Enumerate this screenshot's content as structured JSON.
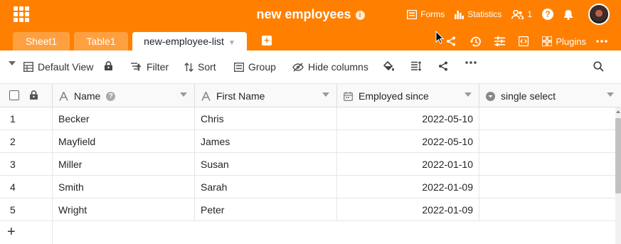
{
  "header": {
    "title": "new employees",
    "info": "i",
    "forms_label": "Forms",
    "statistics_label": "Statistics",
    "collaborators_count": "1",
    "help": "?"
  },
  "tabs": {
    "sheet1": "Sheet1",
    "table1": "Table1",
    "active": "new-employee-list"
  },
  "tab_tools": {
    "plugins_label": "Plugins"
  },
  "toolbar": {
    "view_label": "Default View",
    "filter_label": "Filter",
    "sort_label": "Sort",
    "group_label": "Group",
    "hide_columns_label": "Hide columns"
  },
  "columns": {
    "name": "Name",
    "first_name": "First Name",
    "employed_since": "Employed since",
    "single_select": "single select"
  },
  "rows": [
    {
      "num": "1",
      "name": "Becker",
      "first_name": "Chris",
      "employed_since": "2022-05-10",
      "single_select": ""
    },
    {
      "num": "2",
      "name": "Mayfield",
      "first_name": "James",
      "employed_since": "2022-05-10",
      "single_select": ""
    },
    {
      "num": "3",
      "name": "Miller",
      "first_name": "Susan",
      "employed_since": "2022-01-10",
      "single_select": ""
    },
    {
      "num": "4",
      "name": "Smith",
      "first_name": "Sarah",
      "employed_since": "2022-01-09",
      "single_select": ""
    },
    {
      "num": "5",
      "name": "Wright",
      "first_name": "Peter",
      "employed_since": "2022-01-09",
      "single_select": ""
    }
  ],
  "add_row": "+",
  "colors": {
    "brand": "#ff8000",
    "border": "#dcdcdc"
  },
  "icons": [
    "apps-grid-icon",
    "forms-icon",
    "statistics-icon",
    "users-icon",
    "help-icon",
    "bell-icon",
    "avatar",
    "share-icon",
    "history-icon",
    "settings-icon",
    "code-icon",
    "plugins-icon",
    "more-icon",
    "table-view-icon",
    "lock-icon",
    "filter-icon",
    "sort-icon",
    "group-icon",
    "hide-columns-icon",
    "paint-bucket-icon",
    "row-height-icon",
    "search-icon"
  ]
}
